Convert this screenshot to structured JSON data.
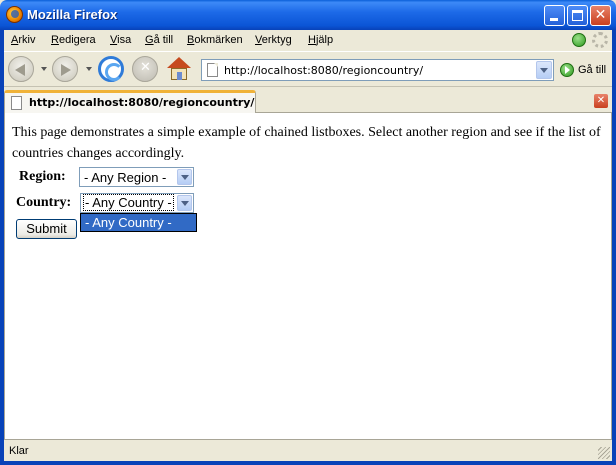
{
  "window": {
    "title": "Mozilla Firefox",
    "buttons": [
      "minimize",
      "maximize",
      "close"
    ]
  },
  "menubar": {
    "items": [
      "Arkiv",
      "Redigera",
      "Visa",
      "Gå till",
      "Bokmärken",
      "Verktyg",
      "Hjälp"
    ]
  },
  "toolbar": {
    "url": "http://localhost:8080/regioncountry/",
    "go_label": "Gå till",
    "icons": [
      "back-icon",
      "forward-icon",
      "reload-icon",
      "stop-icon",
      "home-icon"
    ]
  },
  "tab": {
    "label": "http://localhost:8080/regioncountry/"
  },
  "page": {
    "intro": "This page demonstrates a simple example of chained listboxes. Select another region and see if the list of countries changes accordingly.",
    "region_label": "Region:",
    "region_value": "- Any Region -",
    "country_label": "Country:",
    "country_value": "- Any Country -",
    "country_options": [
      "- Any Country -"
    ],
    "submit_label": "Submit"
  },
  "status": {
    "text": "Klar"
  },
  "colors": {
    "titlebar": "#0b55d6",
    "selection": "#316ac5",
    "tab_accent": "#f0b238"
  }
}
